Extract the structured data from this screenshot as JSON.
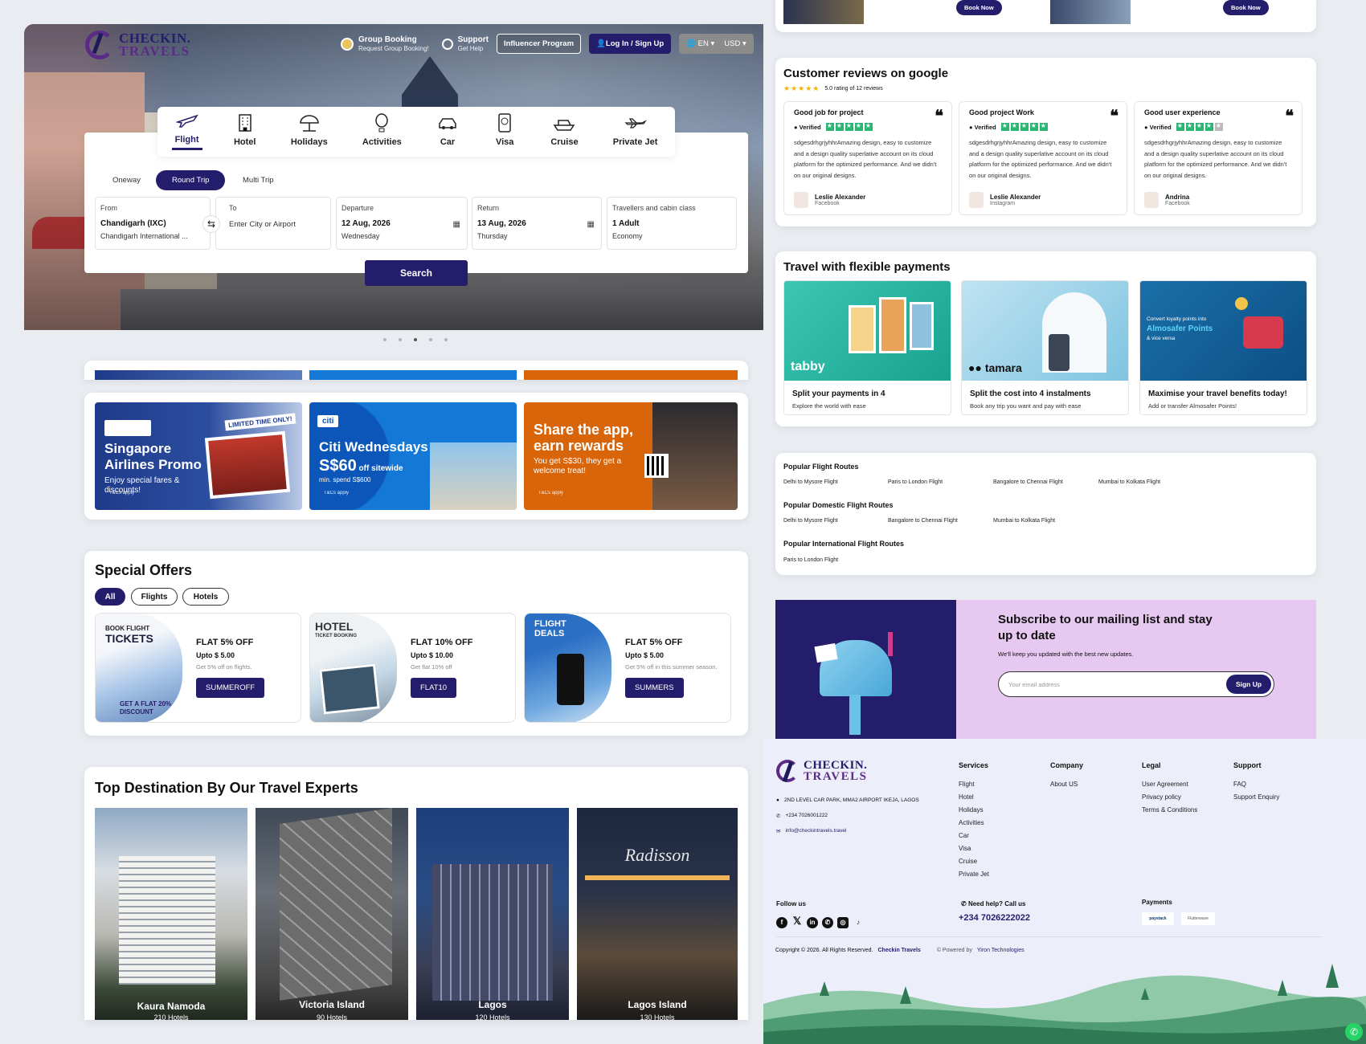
{
  "brand": {
    "line1": "CHECKIN.",
    "line2": "TRAVELS"
  },
  "topnav": {
    "group_title": "Group Booking",
    "group_sub": "Request Group Booking!",
    "support_title": "Support",
    "support_sub": "Get Help",
    "influencer": "Influencer Program",
    "login": "Log In / Sign Up",
    "lang": "EN",
    "currency": "USD"
  },
  "tabs": [
    "Flight",
    "Hotel",
    "Holidays",
    "Activities",
    "Car",
    "Visa",
    "Cruise",
    "Private Jet"
  ],
  "trip_types": [
    "Oneway",
    "Round Trip",
    "Multi Trip"
  ],
  "search": {
    "from_label": "From",
    "from_value": "Chandigarh (IXC)",
    "from_sub": "Chandigarh International ...",
    "to_label": "To",
    "to_placeholder": "Enter City or Airport",
    "dep_label": "Departure",
    "dep_value": "12 Aug, 2026",
    "dep_day": "Wednesday",
    "ret_label": "Return",
    "ret_value": "13 Aug, 2026",
    "ret_day": "Thursday",
    "trav_label": "Travellers and cabin class",
    "trav_value": "1 Adult",
    "trav_class": "Economy",
    "button": "Search"
  },
  "promos": [
    {
      "title": "Singapore Airlines Promo",
      "text": "Enjoy special fares & discounts!",
      "tag": "LIMITED TIME ONLY!",
      "tc": "T&Cs apply",
      "color": "#1e3a8a"
    },
    {
      "title": "Citi Wednesdays",
      "big": "S$60",
      "big_rest": "off sitewide",
      "text": "min. spend S$600",
      "tc": "T&Cs apply",
      "brand": "citi",
      "color": "#1479d6"
    },
    {
      "title": "Share the app, earn rewards",
      "text": "You get S$30, they get a welcome treat!",
      "tc": "T&Cs apply",
      "color": "#d9650a"
    }
  ],
  "offers": {
    "title": "Special Offers",
    "filters": [
      "All",
      "Flights",
      "Hotels"
    ],
    "items": [
      {
        "title": "FLAT 5% OFF",
        "upto": "Upto $ 5.00",
        "desc": "Get 5% off on flights.",
        "code": "SUMMEROFF",
        "img_top": "BOOK FLIGHT",
        "img_big": "TICKETS",
        "img_bottom": "GET A FLAT 20% DISCOUNT"
      },
      {
        "title": "FLAT 10% OFF",
        "upto": "Upto $ 10.00",
        "desc": "Get flat 10% off",
        "code": "FLAT10",
        "img_top": "HOTEL",
        "img_big": "TICKET BOOKING"
      },
      {
        "title": "FLAT 5% OFF",
        "upto": "Upto $ 5.00",
        "desc": "Get 5% off in this summer season.",
        "code": "SUMMERS",
        "img_top": "FLIGHT",
        "img_big": "DEALS"
      }
    ]
  },
  "destinations": {
    "title": "Top Destination By Our Travel Experts",
    "items": [
      {
        "name": "Kaura Namoda",
        "hotels": "210 Hotels"
      },
      {
        "name": "Victoria Island",
        "hotels": "90 Hotels"
      },
      {
        "name": "Lagos",
        "hotels": "120 Hotels"
      },
      {
        "name": "Lagos Island",
        "hotels": "130 Hotels"
      }
    ]
  },
  "book_now": "Book Now",
  "reviews": {
    "title": "Customer reviews on google",
    "rating": "5.0 rating of 12 reviews",
    "items": [
      {
        "head": "Good job for project",
        "verified": "Verified",
        "text": "sdgesdrhgrjyhhrAmazing design, easy to customize and a design quality superlative account on its cloud platform for the optimized performance. And we didn't on our original designs.",
        "author": "Leslie Alexander",
        "source": "Facebook",
        "stars": 5
      },
      {
        "head": "Good project Work",
        "verified": "Verified",
        "text": "sdgesdrhgrjyhhrAmazing design, easy to customize and a design quality superlative account on its cloud platform for the optimized performance. And we didn't on our original designs.",
        "author": "Leslie Alexander",
        "source": "Instagram",
        "stars": 5
      },
      {
        "head": "Good user experience",
        "verified": "Verified",
        "text": "sdgesdrhgrjyhhrAmazing design, easy to customize and a design quality superlative account on its cloud platform for the optimized performance. And we didn't on our original designs.",
        "author": "Andrina",
        "source": "Facebook",
        "stars": 4
      }
    ]
  },
  "payments": {
    "title": "Travel with flexible payments",
    "items": [
      {
        "title": "Split your payments in 4",
        "sub": "Explore the world with ease",
        "brand": "tabby"
      },
      {
        "title": "Split the cost into 4 instalments",
        "sub": "Book any trip you want and pay with ease",
        "brand": "tamara"
      },
      {
        "title": "Maximise your travel benefits today!",
        "sub": "Add or transfer Almosafer Points!",
        "small": "Convert loyalty points into",
        "brand": "Almosafer Points",
        "small2": "& vice versa"
      }
    ]
  },
  "routes": {
    "popular_title": "Popular Flight Routes",
    "popular": [
      "Delhi to Mysore Flight",
      "Paris to London Flight",
      "Bangalore to Chennai Flight",
      "Mumbai to Kolkata Flight"
    ],
    "domestic_title": "Popular Domestic Flight Routes",
    "domestic": [
      "Delhi to Mysore Flight",
      "Bangalore to Chennai Flight",
      "Mumbai to Kolkata Flight"
    ],
    "intl_title": "Popular International Flight Routes",
    "intl": [
      "Paris to London Flight"
    ]
  },
  "subscribe": {
    "title": "Subscribe to our mailing list and stay up to date",
    "sub": "We'll keep you updated with the best new updates.",
    "placeholder": "Your email address",
    "button": "Sign Up"
  },
  "footer": {
    "address": "2ND LEVEL CAR PARK, MMA2 AIRPORT IKEJA, LAGOS",
    "phone": "+234 7026001222",
    "email": "info@checkintravels.travel",
    "services_title": "Services",
    "services": [
      "Flight",
      "Hotel",
      "Holidays",
      "Activities",
      "Car",
      "Visa",
      "Cruise",
      "Private Jet"
    ],
    "company_title": "Company",
    "company": [
      "About US"
    ],
    "legal_title": "Legal",
    "legal": [
      "User Agreement",
      "Privacy policy",
      "Terms & Conditions"
    ],
    "support_title": "Support",
    "support": [
      "FAQ",
      "Support Enquiry"
    ],
    "follow": "Follow us",
    "help": "Need help? Call us",
    "help_phone": "+234 7026222022",
    "payments": "Payments",
    "pay1": "paystack",
    "pay2": "Flutterwave",
    "copyright": "Copyright © 2026. All Rights Reserved.",
    "copy_brand": "Checkin Travels",
    "powered": "© Powered by",
    "powered_brand": "Yiron Technologies"
  },
  "colors": {
    "primary": "#241d6b",
    "accent": "#5b2a86"
  }
}
